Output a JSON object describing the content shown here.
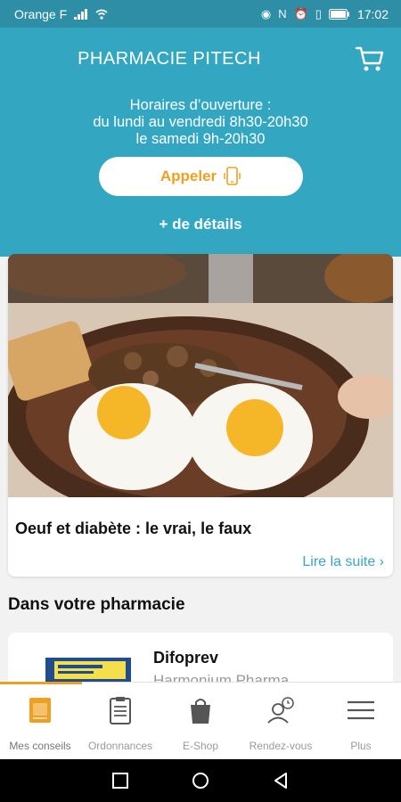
{
  "status_bar": {
    "carrier": "Orange F",
    "time": "17:02",
    "icons": [
      "signal-icon",
      "wifi-icon",
      "eye-icon",
      "nfc-icon",
      "alarm-icon",
      "vibrate-icon",
      "battery-icon"
    ]
  },
  "header": {
    "pharmacy_name": "PHARMACIE PITECH",
    "hours_line1": "Horaires d’ouverture :",
    "hours_line2": "du lundi au vendredi 8h30-20h30",
    "hours_line3": "le samedi 9h-20h30",
    "call_label": "Appeler",
    "details_label": "+ de détails"
  },
  "article": {
    "title": "Oeuf et diabète : le vrai, le faux",
    "read_more": "Lire la suite"
  },
  "section": {
    "title": "Dans votre pharmacie"
  },
  "product": {
    "name": "Difoprev",
    "brand": "Harmonium Pharma"
  },
  "bottom_nav": {
    "items": [
      {
        "label": "Mes conseils",
        "icon": "article-icon",
        "active": true
      },
      {
        "label": "Ordonnances",
        "icon": "clipboard-icon",
        "active": false
      },
      {
        "label": "E-Shop",
        "icon": "shopping-bag-icon",
        "active": false
      },
      {
        "label": "Rendez-vous",
        "icon": "appointment-icon",
        "active": false
      },
      {
        "label": "Plus",
        "icon": "menu-icon",
        "active": false
      }
    ]
  },
  "colors": {
    "primary": "#33a7c2",
    "accent": "#f0a020",
    "link": "#34a9c3"
  }
}
